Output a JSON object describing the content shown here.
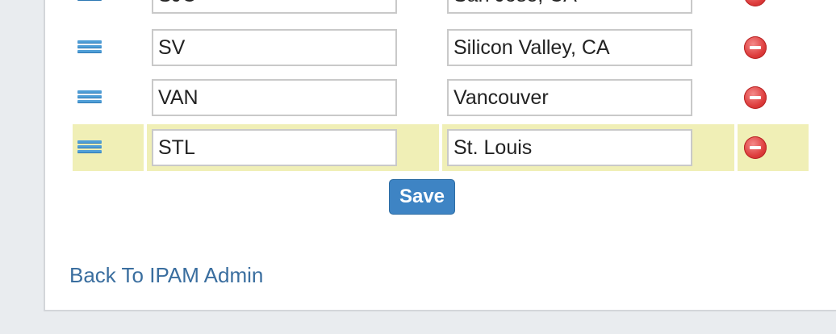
{
  "rows": [
    {
      "code": "SJC",
      "name": "San Jose, CA",
      "highlighted": false
    },
    {
      "code": "SV",
      "name": "Silicon Valley, CA",
      "highlighted": false
    },
    {
      "code": "VAN",
      "name": "Vancouver",
      "highlighted": false
    },
    {
      "code": "STL",
      "name": "St. Louis",
      "highlighted": true
    }
  ],
  "actions": {
    "save_label": "Save"
  },
  "footer": {
    "back_link_label": "Back To IPAM Admin"
  },
  "colors": {
    "highlight": "#f0efb6",
    "save_button": "#3e84c4",
    "delete_icon": "#dd3b3b",
    "link": "#3a6e9f",
    "drag_handle": "#4f9fd8"
  },
  "icons": {
    "drag_handle": "drag-handle-icon",
    "delete": "remove-circle-icon"
  }
}
